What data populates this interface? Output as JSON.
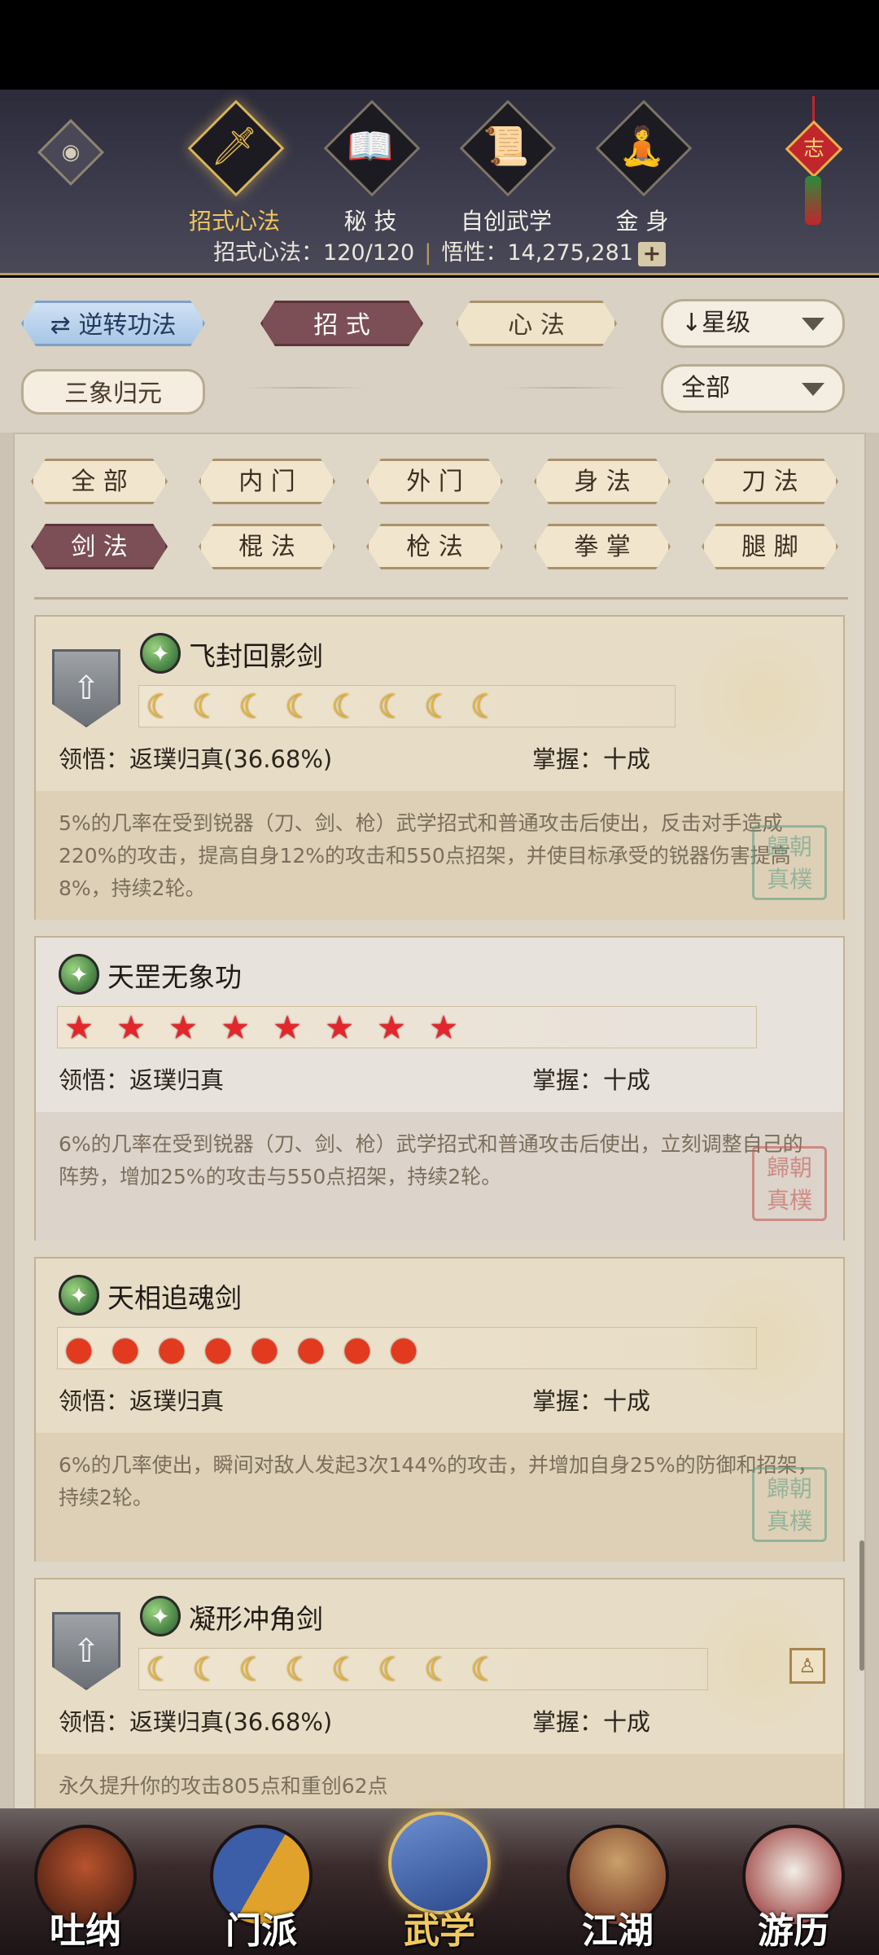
{
  "top_tabs": [
    {
      "label": "招式心法",
      "icon": "sword-icon",
      "glyph": "🗡",
      "active": true
    },
    {
      "label": "秘 技",
      "icon": "book-icon",
      "glyph": "📖",
      "active": false
    },
    {
      "label": "自创武学",
      "icon": "scroll-icon",
      "glyph": "📜",
      "active": false
    },
    {
      "label": "金 身",
      "icon": "meditation-icon",
      "glyph": "🧘",
      "active": false
    }
  ],
  "knot_label": "志",
  "stats": {
    "moves_label": "招式心法：120/120",
    "insight_label": "悟性：14,275,281",
    "plus": "+"
  },
  "filter": {
    "reverse_button": "逆转功法",
    "reverse_icon": "⇄",
    "tab_moves": "招 式",
    "tab_mind": "心 法",
    "sanxiang_button": "三象归元",
    "sort_dropdown": "↓星级",
    "scope_dropdown": "全部"
  },
  "categories": [
    "全 部",
    "内 门",
    "外 门",
    "身 法",
    "刀 法",
    "剑 法",
    "棍 法",
    "枪 法",
    "拳 掌",
    "腿 脚"
  ],
  "active_category": "剑 法",
  "cards": [
    {
      "name": "飞封回影剑",
      "rating_type": "moon",
      "rating_glyph": "☾",
      "rating_count": 8,
      "comprehension": "领悟：返璞归真(36.68%)",
      "mastery": "掌握：十成",
      "description": "5%的几率在受到锐器（刀、剑、枪）武学招式和普通攻击后使出，反击对手造成220%的攻击，提高自身12%的攻击和550点招架，并使目标承受的锐器伤害提高8%，持续2轮。",
      "stamp": "歸朝\n真樸",
      "stamp_color": "green",
      "upgrade": true
    },
    {
      "name": "天罡无象功",
      "rating_type": "star",
      "rating_glyph": "★",
      "rating_count": 8,
      "comprehension": "领悟：返璞归真",
      "mastery": "掌握：十成",
      "description": "6%的几率在受到锐器（刀、剑、枪）武学招式和普通攻击后使出，立刻调整自己的阵势，增加25%的攻击与550点招架，持续2轮。",
      "stamp": "歸朝\n真樸",
      "stamp_color": "red",
      "upgrade": false
    },
    {
      "name": "天相追魂剑",
      "rating_type": "fire",
      "rating_glyph": "●",
      "rating_count": 8,
      "comprehension": "领悟：返璞归真",
      "mastery": "掌握：十成",
      "description": "6%的几率使出，瞬间对敌人发起3次144%的攻击，并增加自身25%的防御和招架，持续2轮。",
      "stamp": "歸朝\n真樸",
      "stamp_color": "green",
      "upgrade": false
    },
    {
      "name": "凝形冲角剑",
      "rating_type": "moon",
      "rating_glyph": "☾",
      "rating_count": 8,
      "comprehension": "领悟：返璞归真(36.68%)",
      "mastery": "掌握：十成",
      "description": "永久提升你的攻击805点和重创62点",
      "stamp": "",
      "stamp_color": "green",
      "upgrade": true
    }
  ],
  "bottom_nav": [
    {
      "label": "吐纳",
      "icon": "monk-icon",
      "color": "#7a2a1c",
      "active": false
    },
    {
      "label": "门派",
      "icon": "sect-flag-icon",
      "color": "#3c5ea8",
      "active": false
    },
    {
      "label": "武学",
      "icon": "martial-book-icon",
      "color": "#3a5c9c",
      "active": true
    },
    {
      "label": "江湖",
      "icon": "bamboo-hat-icon",
      "color": "#8a6a3a",
      "active": false
    },
    {
      "label": "游历",
      "icon": "white-horse-icon",
      "color": "#d9d4cc",
      "active": false
    }
  ],
  "colors": {
    "accent_gold": "#f1c65b",
    "active_tab": "#7b4f55",
    "panel": "#ded6c7"
  }
}
